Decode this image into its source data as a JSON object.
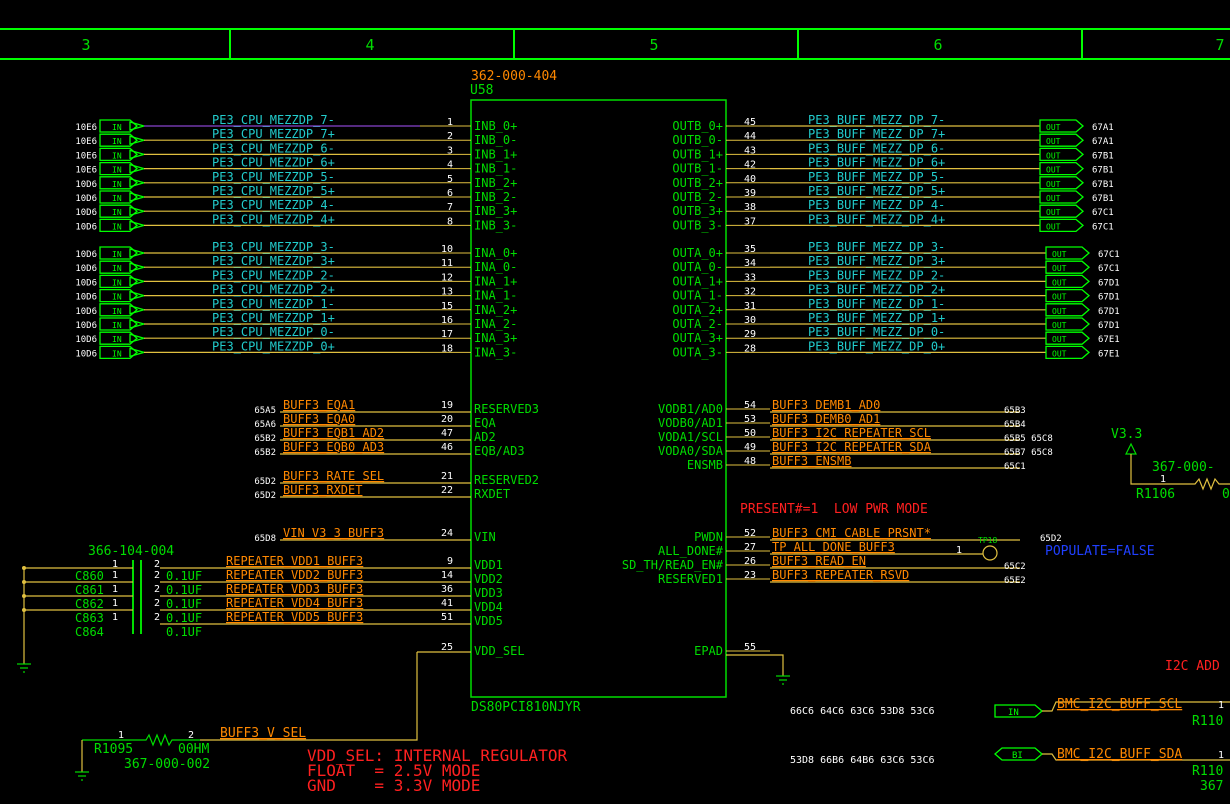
{
  "colors": {
    "background": "#000000",
    "frame": "#00ff00",
    "component": "#00dd00",
    "net_cyan": "#22cccc",
    "net_orange": "#ff8800",
    "wire_yellow": "#e0c040",
    "note_red": "#ff2020",
    "note_blue": "#2040ff"
  },
  "zones": [
    "3",
    "4",
    "5",
    "6",
    "7"
  ],
  "chip": {
    "part_number": "362-000-404",
    "refdes": "U58",
    "name": "DS80PCI810NJYR",
    "left_pins": [
      {
        "num": "1",
        "name": "INB_0+"
      },
      {
        "num": "2",
        "name": "INB_0-"
      },
      {
        "num": "3",
        "name": "INB_1+"
      },
      {
        "num": "4",
        "name": "INB_1-"
      },
      {
        "num": "5",
        "name": "INB_2+"
      },
      {
        "num": "6",
        "name": "INB_2-"
      },
      {
        "num": "7",
        "name": "INB_3+"
      },
      {
        "num": "8",
        "name": "INB_3-"
      },
      {
        "num": "10",
        "name": "INA_0+"
      },
      {
        "num": "11",
        "name": "INA_0-"
      },
      {
        "num": "12",
        "name": "INA_1+"
      },
      {
        "num": "13",
        "name": "INA_1-"
      },
      {
        "num": "15",
        "name": "INA_2+"
      },
      {
        "num": "16",
        "name": "INA_2-"
      },
      {
        "num": "17",
        "name": "INA_3+"
      },
      {
        "num": "18",
        "name": "INA_3-"
      },
      {
        "num": "19",
        "name": "RESERVED3"
      },
      {
        "num": "20",
        "name": "EQA"
      },
      {
        "num": "47",
        "name": "AD2"
      },
      {
        "num": "46",
        "name": "EQB/AD3"
      },
      {
        "num": "21",
        "name": "RESERVED2"
      },
      {
        "num": "22",
        "name": "RXDET"
      },
      {
        "num": "24",
        "name": "VIN"
      },
      {
        "num": "9",
        "name": "VDD1"
      },
      {
        "num": "14",
        "name": "VDD2"
      },
      {
        "num": "36",
        "name": "VDD3"
      },
      {
        "num": "41",
        "name": "VDD4"
      },
      {
        "num": "51",
        "name": "VDD5"
      },
      {
        "num": "25",
        "name": "VDD_SEL"
      }
    ],
    "right_pins": [
      {
        "num": "45",
        "name": "OUTB_0+"
      },
      {
        "num": "44",
        "name": "OUTB_0-"
      },
      {
        "num": "43",
        "name": "OUTB_1+"
      },
      {
        "num": "42",
        "name": "OUTB_1-"
      },
      {
        "num": "40",
        "name": "OUTB_2+"
      },
      {
        "num": "39",
        "name": "OUTB_2-"
      },
      {
        "num": "38",
        "name": "OUTB_3+"
      },
      {
        "num": "37",
        "name": "OUTB_3-"
      },
      {
        "num": "35",
        "name": "OUTA_0+"
      },
      {
        "num": "34",
        "name": "OUTA_0-"
      },
      {
        "num": "33",
        "name": "OUTA_1+"
      },
      {
        "num": "32",
        "name": "OUTA_1-"
      },
      {
        "num": "31",
        "name": "OUTA_2+"
      },
      {
        "num": "30",
        "name": "OUTA_2-"
      },
      {
        "num": "29",
        "name": "OUTA_3+"
      },
      {
        "num": "28",
        "name": "OUTA_3-"
      },
      {
        "num": "54",
        "name": "VODB1/AD0"
      },
      {
        "num": "53",
        "name": "VODB0/AD1"
      },
      {
        "num": "50",
        "name": "VODA1/SCL"
      },
      {
        "num": "49",
        "name": "VODA0/SDA"
      },
      {
        "num": "48",
        "name": "ENSMB"
      },
      {
        "num": "52",
        "name": "PWDN"
      },
      {
        "num": "27",
        "name": "ALL_DONE#"
      },
      {
        "num": "26",
        "name": "SD_TH/READ_EN#"
      },
      {
        "num": "23",
        "name": "RESERVED1"
      },
      {
        "num": "55",
        "name": "EPAD"
      }
    ]
  },
  "in_nets": [
    {
      "ref": "10E6",
      "net": "PE3_CPU_MEZZDP_7-"
    },
    {
      "ref": "10E6",
      "net": "PE3_CPU_MEZZDP_7+"
    },
    {
      "ref": "10E6",
      "net": "PE3_CPU_MEZZDP_6-"
    },
    {
      "ref": "10E6",
      "net": "PE3_CPU_MEZZDP_6+"
    },
    {
      "ref": "10D6",
      "net": "PE3_CPU_MEZZDP_5-"
    },
    {
      "ref": "10D6",
      "net": "PE3_CPU_MEZZDP_5+"
    },
    {
      "ref": "10D6",
      "net": "PE3_CPU_MEZZDP_4-"
    },
    {
      "ref": "10D6",
      "net": "PE3_CPU_MEZZDP_4+"
    },
    {
      "ref": "10D6",
      "net": "PE3_CPU_MEZZDP_3-"
    },
    {
      "ref": "10D6",
      "net": "PE3_CPU_MEZZDP_3+"
    },
    {
      "ref": "10D6",
      "net": "PE3_CPU_MEZZDP_2-"
    },
    {
      "ref": "10D6",
      "net": "PE3_CPU_MEZZDP_2+"
    },
    {
      "ref": "10D6",
      "net": "PE3_CPU_MEZZDP_1-"
    },
    {
      "ref": "10D6",
      "net": "PE3_CPU_MEZZDP_1+"
    },
    {
      "ref": "10D6",
      "net": "PE3_CPU_MEZZDP_0-"
    },
    {
      "ref": "10D6",
      "net": "PE3_CPU_MEZZDP_0+"
    }
  ],
  "out_nets": [
    {
      "net": "PE3_BUFF_MEZZ_DP_7-",
      "ref": "67A1"
    },
    {
      "net": "PE3_BUFF_MEZZ_DP_7+",
      "ref": "67A1"
    },
    {
      "net": "PE3_BUFF_MEZZ_DP_6-",
      "ref": "67B1"
    },
    {
      "net": "PE3_BUFF_MEZZ_DP_6+",
      "ref": "67B1"
    },
    {
      "net": "PE3_BUFF_MEZZ_DP_5-",
      "ref": "67B1"
    },
    {
      "net": "PE3_BUFF_MEZZ_DP_5+",
      "ref": "67B1"
    },
    {
      "net": "PE3_BUFF_MEZZ_DP_4-",
      "ref": "67C1"
    },
    {
      "net": "PE3_BUFF_MEZZ_DP_4+",
      "ref": "67C1"
    },
    {
      "net": "PE3_BUFF_MEZZ_DP_3-",
      "ref": "67C1"
    },
    {
      "net": "PE3_BUFF_MEZZ_DP_3+",
      "ref": "67C1"
    },
    {
      "net": "PE3_BUFF_MEZZ_DP_2-",
      "ref": "67D1"
    },
    {
      "net": "PE3_BUFF_MEZZ_DP_2+",
      "ref": "67D1"
    },
    {
      "net": "PE3_BUFF_MEZZ_DP_1-",
      "ref": "67D1"
    },
    {
      "net": "PE3_BUFF_MEZZ_DP_1+",
      "ref": "67D1"
    },
    {
      "net": "PE3_BUFF_MEZZ_DP_0-",
      "ref": "67E1"
    },
    {
      "net": "PE3_BUFF_MEZZ_DP_0+",
      "ref": "67E1"
    }
  ],
  "left_ctrl": [
    {
      "ref": "65A5",
      "net": "BUFF3_EQA1"
    },
    {
      "ref": "65A6",
      "net": "BUFF3_EQA0"
    },
    {
      "ref": "65B2",
      "net": "BUFF3_EQB1_AD2"
    },
    {
      "ref": "65B2",
      "net": "BUFF3_EQB0_AD3"
    },
    {
      "ref": "65D2",
      "net": "BUFF3_RATE_SEL"
    },
    {
      "ref": "65D2",
      "net": "BUFF3_RXDET"
    },
    {
      "ref": "65D8",
      "net": "VIN_V3_3_BUFF3"
    }
  ],
  "right_ctrl": [
    {
      "net": "BUFF3_DEMB1_AD0",
      "ref": "65B3"
    },
    {
      "net": "BUFF3_DEMB0_AD1",
      "ref": "65B4"
    },
    {
      "net": "BUFF3_I2C_REPEATER_SCL",
      "ref": "65B5 65C8"
    },
    {
      "net": "BUFF3_I2C_REPEATER_SDA",
      "ref": "65B7 65C8"
    },
    {
      "net": "BUFF3_ENSMB",
      "ref": "65C1"
    },
    {
      "net": "BUFF3_CMI_CABLE_PRSNT*",
      "ref": "65D2"
    },
    {
      "net": "TP_ALL_DONE_BUFF3",
      "ref": ""
    },
    {
      "net": "BUFF3_READ_EN",
      "ref": "65C2"
    },
    {
      "net": "BUFF3_REPEATER_RSVD",
      "ref": "65E2"
    }
  ],
  "vdd_nets": [
    "REPEATER_VDD1_BUFF3",
    "REPEATER_VDD2_BUFF3",
    "REPEATER_VDD3_BUFF3",
    "REPEATER_VDD4_BUFF3",
    "REPEATER_VDD5_BUFF3"
  ],
  "caps": {
    "part_number": "366-104-004",
    "pin1": "1",
    "pin2": "2",
    "items": [
      {
        "ref": "C860",
        "value": "0.1UF"
      },
      {
        "ref": "C861",
        "value": "0.1UF"
      },
      {
        "ref": "C862",
        "value": "0.1UF"
      },
      {
        "ref": "C863",
        "value": "0.1UF"
      },
      {
        "ref": "C864",
        "value": "0.1UF"
      }
    ]
  },
  "resistor_vdd": {
    "pin1": "1",
    "pin2": "2",
    "net": "BUFF3_V_SEL",
    "ref": "R1095",
    "value": "00HM",
    "part_number": "367-000-002"
  },
  "notes": {
    "low_pwr": "PRESENT#=1  LOW PWR MODE",
    "populate": "POPULATE=FALSE",
    "vdd_sel_1": "VDD_SEL: INTERNAL REGULATOR",
    "vdd_sel_2": "FLOAT  = 2.5V MODE",
    "vdd_sel_3": "GND    = 3.3V MODE",
    "i2c": "I2C ADD"
  },
  "tp": {
    "ref": "TP18",
    "pin": "1"
  },
  "rail": {
    "name": "V3.3",
    "part_number": "367-000-",
    "ref": "R1106",
    "pin": "1",
    "value": "0"
  },
  "bmc": {
    "scl_refs": "66C6 64C6 63C6 53D8 53C6",
    "scl_net": "BMC_I2C_BUFF_SCL",
    "scl_pin": "1",
    "scl_rref": "R110",
    "sda_refs": "53D8 66B6 64B6 63C6 53C6",
    "sda_net": "BMC_I2C_BUFF_SDA",
    "sda_pin": "1",
    "sda_rref": "R110",
    "sda_pn": "367"
  },
  "port_labels": {
    "in": "IN",
    "out": "OUT",
    "bi": "BI"
  }
}
